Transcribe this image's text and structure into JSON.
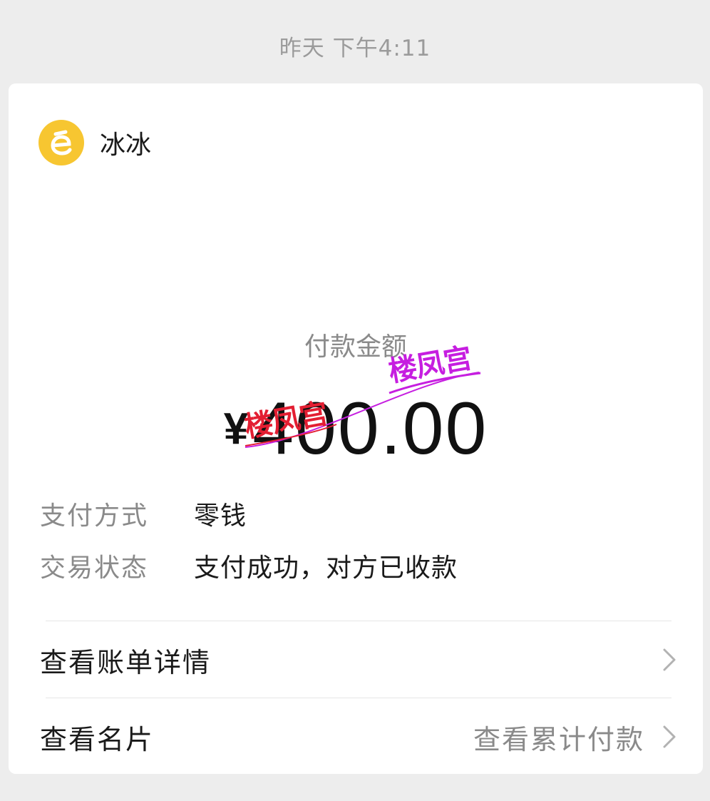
{
  "timestamp": "昨天 下午4:11",
  "payee": {
    "name": "冰冰",
    "avatar_icon": "letter-e-avatar-icon",
    "avatar_color": "#f7c631"
  },
  "payment": {
    "amount_label": "付款金额",
    "currency_symbol": "¥",
    "amount": "400.00"
  },
  "details": [
    {
      "label": "支付方式",
      "value": "零钱"
    },
    {
      "label": "交易状态",
      "value": "支付成功，对方已收款"
    }
  ],
  "links": {
    "bill_details": {
      "label": "查看账单详情",
      "icon": "chevron-right-icon"
    },
    "profile_card": {
      "label": "查看名片",
      "extra": "查看累计付款",
      "icon": "chevron-right-icon"
    }
  },
  "watermark": {
    "text_1": "楼凤宫",
    "text_2": "楼凤宫",
    "color_1": "#c61ee0",
    "color_2": "#e31e32"
  }
}
